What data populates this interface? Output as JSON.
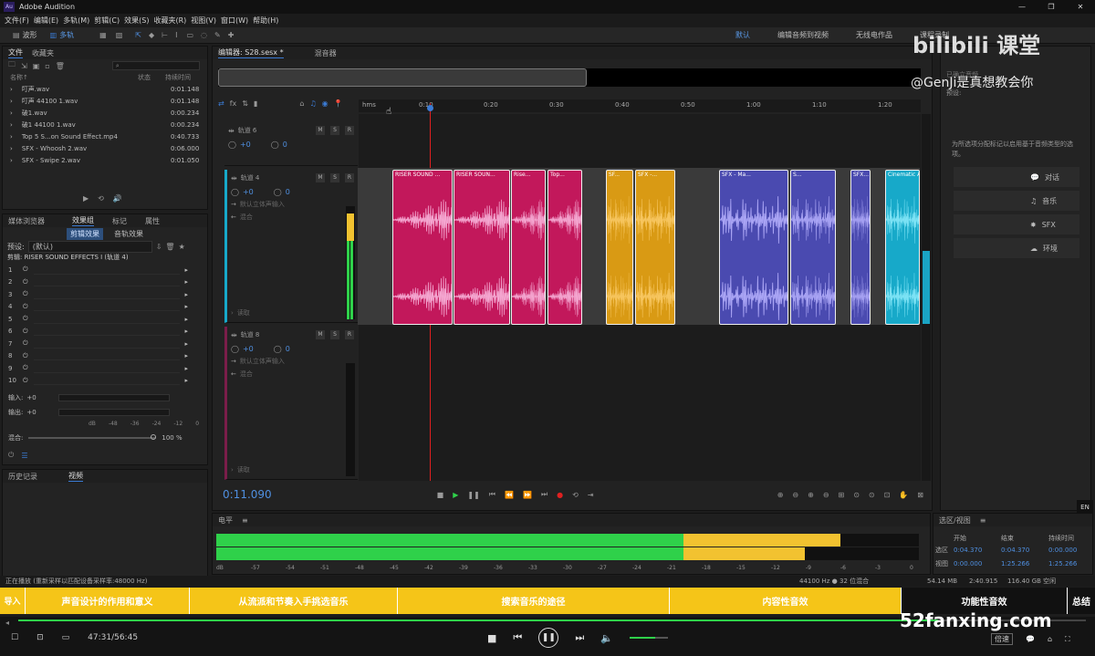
{
  "app": {
    "title": "Adobe Audition",
    "logo": "Au"
  },
  "window_controls": {
    "minimize": "—",
    "restore": "❐",
    "close": "✕"
  },
  "menu": [
    "文件(F)",
    "编辑(E)",
    "多轨(M)",
    "剪辑(C)",
    "效果(S)",
    "收藏夹(R)",
    "视图(V)",
    "窗口(W)",
    "帮助(H)"
  ],
  "toolbar": {
    "waveform": "波形",
    "multitrack": "多轨",
    "workspaces": [
      "默认",
      "编辑音频到视频",
      "无线电作品",
      "课程录制"
    ]
  },
  "files_panel": {
    "tabs": [
      "文件",
      "收藏夹"
    ],
    "columns": [
      "名称↑",
      "状态",
      "持续时间"
    ],
    "files": [
      {
        "name": "叮声.wav",
        "duration": "0:01.148"
      },
      {
        "name": "叮声 44100 1.wav",
        "duration": "0:01.148"
      },
      {
        "name": "破1.wav",
        "duration": "0:00.234"
      },
      {
        "name": "破1 44100 1.wav",
        "duration": "0:00.234"
      },
      {
        "name": "Top 5 S...on Sound Effect.mp4",
        "duration": "0:40.733"
      },
      {
        "name": "SFX - Whoosh 2.wav",
        "duration": "0:06.000"
      },
      {
        "name": "SFX - Swipe 2.wav",
        "duration": "0:01.050"
      }
    ]
  },
  "effects_panel": {
    "tabs": [
      "媒体浏览器",
      "效果组",
      "标记",
      "属性"
    ],
    "subtabs": [
      "剪辑效果",
      "音轨效果"
    ],
    "preset_label": "预设:",
    "preset_value": "(默认)",
    "clip_label": "剪辑: RISER SOUND EFFECTS I (轨道 4)",
    "slots": [
      "1",
      "2",
      "3",
      "4",
      "5",
      "6",
      "7",
      "8",
      "9",
      "10"
    ],
    "input_label": "输入:",
    "input_val": "+0",
    "output_label": "输出:",
    "output_val": "+0",
    "db_scale": [
      "dB",
      "-48",
      "-36",
      "-24",
      "-12",
      "0"
    ],
    "mix_label": "混合:",
    "mix_val": "100 %"
  },
  "history_panel": {
    "tabs": [
      "历史记录",
      "视频"
    ]
  },
  "editor": {
    "tab": "编辑器: S28.sesx *",
    "mixer_tab": "混音器",
    "ruler": [
      "hms",
      "0:10",
      "0:20",
      "0:30",
      "0:40",
      "0:50",
      "1:00",
      "1:10",
      "1:20"
    ],
    "tracks": [
      {
        "name": "轨道 6",
        "vol": "+0",
        "pan": "0"
      },
      {
        "name": "轨道 4",
        "vol": "+0",
        "pan": "0",
        "input": "默认立体声输入",
        "output": "混合",
        "read": "读取"
      },
      {
        "name": "轨道 8",
        "vol": "+0",
        "pan": "0",
        "input": "默认立体声输入",
        "output": "混合",
        "read": "读取"
      }
    ],
    "clips": [
      {
        "label": "RISER SOUND ..."
      },
      {
        "label": "RISER SOUN..."
      },
      {
        "label": "Rise..."
      },
      {
        "label": "Top..."
      },
      {
        "label": "SF..."
      },
      {
        "label": "SFX -..."
      },
      {
        "label": "SFX - Ma..."
      },
      {
        "label": "S..."
      },
      {
        "label": "SFX..."
      },
      {
        "label": "Cinematic Al"
      }
    ],
    "time": "0:11.090"
  },
  "right_panel": {
    "hint": "为所选项分配标记以启用基于音频类型的选项。",
    "preset_label": "预设:",
    "buttons": [
      "对话",
      "音乐",
      "SFX",
      "环境"
    ],
    "header_left": "已确立音频"
  },
  "level_panel": {
    "title": "电平",
    "scale": [
      "dB",
      "-57",
      "-54",
      "-51",
      "-48",
      "-45",
      "-42",
      "-39",
      "-36",
      "-33",
      "-30",
      "-27",
      "-24",
      "-21",
      "-18",
      "-15",
      "-12",
      "-9",
      "-6",
      "-3",
      "0"
    ],
    "level1": 0.888,
    "level2": 0.838,
    "warn_start": 0.665
  },
  "selection_panel": {
    "title": "选区/视图",
    "cols": [
      "开始",
      "结束",
      "持续时间"
    ],
    "rows": [
      {
        "label": "选区",
        "start": "0:04.370",
        "end": "0:04.370",
        "dur": "0:00.000"
      },
      {
        "label": "视图",
        "start": "0:00.000",
        "end": "1:25.266",
        "dur": "1:25.266"
      }
    ]
  },
  "status": {
    "left": "正在播放 (重新采样以匹配设备采样率:48000 Hz)",
    "format": "44100 Hz ● 32 位混合",
    "size": "54.14 MB",
    "dur": "2:40.915",
    "free": "116.40 GB 空闲"
  },
  "overlay": {
    "brand": "bilibili 课堂",
    "author": "@GenJi是真想教会你",
    "site": "52fanxing.com"
  },
  "chapters": [
    "导入",
    "声音设计的作用和意义",
    "从流派和节奏入手挑选音乐",
    "搜索音乐的途径",
    "内容性音效",
    "功能性音效",
    "总结"
  ],
  "player": {
    "time": "47:31/56:45",
    "speed": "倍速",
    "lang": "EN"
  },
  "colors": {
    "accent": "#3b7bd4",
    "playhead": "#e02020",
    "pink": "#c2185b",
    "gold": "#d99a14",
    "violet": "#4a4ab0",
    "cyan": "#17a9c9",
    "chapter": "#f5c518",
    "meter_green": "#2fd14a",
    "meter_yellow": "#f2c230"
  }
}
